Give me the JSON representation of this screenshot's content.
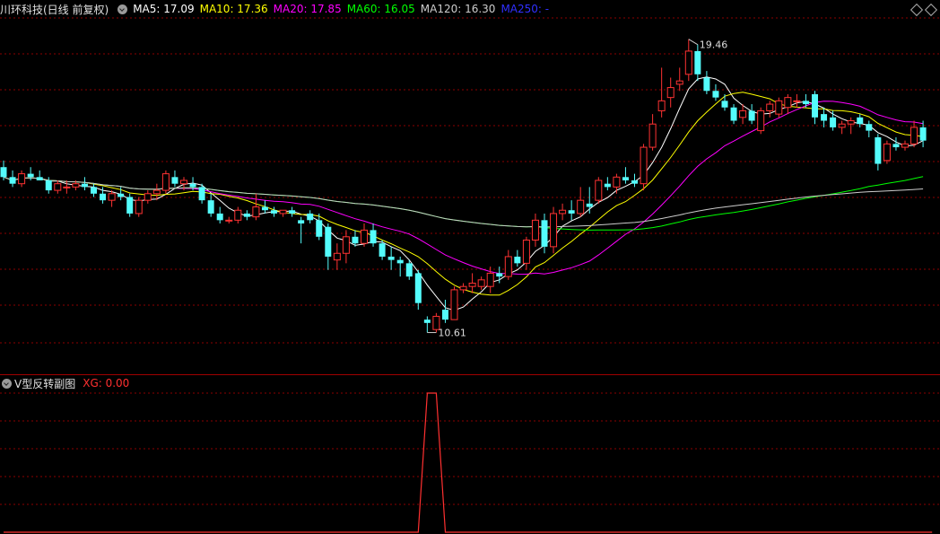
{
  "header": {
    "stock": "川环科技(日线 前复权)",
    "ma": [
      {
        "label": "MA5: 17.09",
        "color": "#ffffff"
      },
      {
        "label": "MA10: 17.36",
        "color": "#ffff00"
      },
      {
        "label": "MA20: 17.85",
        "color": "#ff00ff"
      },
      {
        "label": "MA60: 16.05",
        "color": "#00ff00"
      },
      {
        "label": "MA120: 16.30",
        "color": "#cccccc"
      },
      {
        "label": "MA250: -",
        "color": "#3030ff"
      }
    ]
  },
  "sub": {
    "title": "V型反转副图",
    "xg_label": "XG: 0.00",
    "xg_color": "#ff3030"
  },
  "annotations": {
    "high": "19.46",
    "low": "10.61"
  },
  "colors": {
    "up": "#ff3232",
    "down": "#54fcfc",
    "grid": "#8b0000"
  },
  "chart_data": {
    "type": "candlestick",
    "ylim": [
      10.3,
      20.1
    ],
    "ohlc": [
      [
        15.6,
        15.8,
        15.2,
        15.3
      ],
      [
        15.3,
        15.5,
        15.0,
        15.1
      ],
      [
        15.1,
        15.5,
        15.0,
        15.4
      ],
      [
        15.4,
        15.6,
        15.2,
        15.3
      ],
      [
        15.3,
        15.5,
        15.2,
        15.2
      ],
      [
        15.2,
        15.3,
        14.8,
        14.9
      ],
      [
        14.9,
        15.2,
        14.8,
        15.1
      ],
      [
        15.0,
        15.2,
        14.8,
        15.0
      ],
      [
        15.0,
        15.2,
        14.9,
        15.1
      ],
      [
        15.1,
        15.3,
        14.9,
        15.0
      ],
      [
        15.0,
        15.1,
        14.7,
        14.8
      ],
      [
        14.8,
        15.0,
        14.5,
        14.6
      ],
      [
        14.6,
        14.9,
        14.4,
        14.8
      ],
      [
        14.8,
        15.0,
        14.6,
        14.7
      ],
      [
        14.7,
        14.8,
        14.1,
        14.2
      ],
      [
        14.2,
        14.7,
        14.1,
        14.6
      ],
      [
        14.6,
        14.9,
        14.5,
        14.8
      ],
      [
        14.8,
        15.1,
        14.6,
        14.9
      ],
      [
        14.9,
        15.5,
        14.8,
        15.4
      ],
      [
        15.3,
        15.5,
        15.0,
        15.1
      ],
      [
        15.1,
        15.3,
        14.9,
        15.2
      ],
      [
        15.1,
        15.3,
        14.9,
        15.0
      ],
      [
        15.0,
        15.1,
        14.5,
        14.6
      ],
      [
        14.6,
        14.8,
        14.1,
        14.2
      ],
      [
        14.2,
        14.4,
        13.9,
        14.0
      ],
      [
        14.0,
        14.1,
        13.9,
        14.0
      ],
      [
        14.0,
        14.4,
        13.9,
        14.3
      ],
      [
        14.2,
        14.3,
        14.0,
        14.1
      ],
      [
        14.1,
        14.8,
        14.0,
        14.4
      ],
      [
        14.4,
        14.6,
        14.2,
        14.3
      ],
      [
        14.3,
        14.4,
        14.1,
        14.2
      ],
      [
        14.2,
        14.3,
        14.1,
        14.3
      ],
      [
        14.3,
        14.4,
        14.1,
        14.2
      ],
      [
        14.0,
        14.1,
        13.3,
        13.9
      ],
      [
        14.2,
        14.3,
        13.9,
        14.0
      ],
      [
        14.0,
        14.2,
        13.4,
        13.5
      ],
      [
        13.8,
        13.9,
        12.5,
        12.9
      ],
      [
        12.8,
        13.3,
        12.5,
        13.0
      ],
      [
        13.0,
        13.7,
        12.7,
        13.5
      ],
      [
        13.5,
        13.7,
        13.2,
        13.3
      ],
      [
        13.3,
        13.9,
        13.2,
        13.7
      ],
      [
        13.7,
        13.9,
        13.2,
        13.3
      ],
      [
        13.3,
        13.4,
        12.8,
        12.9
      ],
      [
        12.9,
        13.2,
        12.5,
        12.8
      ],
      [
        12.8,
        12.9,
        12.3,
        12.7
      ],
      [
        12.7,
        12.8,
        12.2,
        12.3
      ],
      [
        12.4,
        12.5,
        11.3,
        11.5
      ],
      [
        11.0,
        11.1,
        10.61,
        10.9
      ],
      [
        10.7,
        11.2,
        10.61,
        11.1
      ],
      [
        11.3,
        11.6,
        10.9,
        11.0
      ],
      [
        11.0,
        12.0,
        11.0,
        11.9
      ],
      [
        11.9,
        12.1,
        11.8,
        12.0
      ],
      [
        12.0,
        12.4,
        11.8,
        12.1
      ],
      [
        12.0,
        12.3,
        11.9,
        12.2
      ],
      [
        12.0,
        12.6,
        11.8,
        12.4
      ],
      [
        12.4,
        12.6,
        12.1,
        12.3
      ],
      [
        12.3,
        13.1,
        12.2,
        12.9
      ],
      [
        12.9,
        13.1,
        12.6,
        12.7
      ],
      [
        12.7,
        13.5,
        12.5,
        13.4
      ],
      [
        13.4,
        14.2,
        13.2,
        14.0
      ],
      [
        14.0,
        14.2,
        13.0,
        13.2
      ],
      [
        13.2,
        14.4,
        13.0,
        14.2
      ],
      [
        14.2,
        14.5,
        14.0,
        14.3
      ],
      [
        14.3,
        14.6,
        14.0,
        14.2
      ],
      [
        14.2,
        15.0,
        14.1,
        14.6
      ],
      [
        14.5,
        15.0,
        14.2,
        14.4
      ],
      [
        14.6,
        15.3,
        14.5,
        15.2
      ],
      [
        15.1,
        15.3,
        14.9,
        15.0
      ],
      [
        15.0,
        15.4,
        14.8,
        15.3
      ],
      [
        15.3,
        15.6,
        15.1,
        15.2
      ],
      [
        15.2,
        15.4,
        15.0,
        15.1
      ],
      [
        15.1,
        16.3,
        14.9,
        16.2
      ],
      [
        16.2,
        17.2,
        16.1,
        16.9
      ],
      [
        17.3,
        18.6,
        17.1,
        17.6
      ],
      [
        17.7,
        18.3,
        17.4,
        18.0
      ],
      [
        18.1,
        18.6,
        17.9,
        18.2
      ],
      [
        18.4,
        19.46,
        18.2,
        19.1
      ],
      [
        19.1,
        19.3,
        18.2,
        18.4
      ],
      [
        18.3,
        18.5,
        17.8,
        17.9
      ],
      [
        17.9,
        18.1,
        17.6,
        17.7
      ],
      [
        17.6,
        17.8,
        17.3,
        17.4
      ],
      [
        17.4,
        17.5,
        16.9,
        17.0
      ],
      [
        17.1,
        17.5,
        16.9,
        17.3
      ],
      [
        17.3,
        17.5,
        16.9,
        17.0
      ],
      [
        16.7,
        17.4,
        16.6,
        17.3
      ],
      [
        17.3,
        17.6,
        17.1,
        17.5
      ],
      [
        17.2,
        17.7,
        17.1,
        17.6
      ],
      [
        17.4,
        17.8,
        17.2,
        17.7
      ],
      [
        17.6,
        17.8,
        17.4,
        17.6
      ],
      [
        17.6,
        17.8,
        17.4,
        17.5
      ],
      [
        17.8,
        17.9,
        16.9,
        17.1
      ],
      [
        17.2,
        17.4,
        16.8,
        17.0
      ],
      [
        17.1,
        17.3,
        16.7,
        16.8
      ],
      [
        16.8,
        17.0,
        16.6,
        16.9
      ],
      [
        16.9,
        17.1,
        16.6,
        17.0
      ],
      [
        17.1,
        17.2,
        16.8,
        16.9
      ],
      [
        16.9,
        17.0,
        16.5,
        16.7
      ],
      [
        16.5,
        16.6,
        15.5,
        15.7
      ],
      [
        15.8,
        16.4,
        15.7,
        16.3
      ],
      [
        16.3,
        16.5,
        16.1,
        16.2
      ],
      [
        16.2,
        16.4,
        16.1,
        16.3
      ],
      [
        16.3,
        17.0,
        16.2,
        16.8
      ],
      [
        16.8,
        17.0,
        16.2,
        16.4
      ]
    ],
    "xg": [
      0,
      0,
      0,
      0,
      0,
      0,
      0,
      0,
      0,
      0,
      0,
      0,
      0,
      0,
      0,
      0,
      0,
      0,
      0,
      0,
      0,
      0,
      0,
      0,
      0,
      0,
      0,
      0,
      0,
      0,
      0,
      0,
      0,
      0,
      0,
      0,
      0,
      0,
      0,
      0,
      0,
      0,
      0,
      0,
      0,
      0,
      0,
      1,
      1,
      0,
      0,
      0,
      0,
      0,
      0,
      0,
      0,
      0,
      0,
      0,
      0,
      0,
      0,
      0,
      0,
      0,
      0,
      0,
      0,
      0,
      0,
      0,
      0,
      0,
      0,
      0,
      0,
      0,
      0,
      0,
      0,
      0,
      0,
      0,
      0,
      0,
      0,
      0,
      0,
      0,
      0,
      0,
      0,
      0,
      0,
      0,
      0,
      0,
      0,
      0,
      0,
      0,
      0,
      0
    ],
    "ma_periods": [
      5,
      10,
      20,
      60,
      120
    ]
  }
}
